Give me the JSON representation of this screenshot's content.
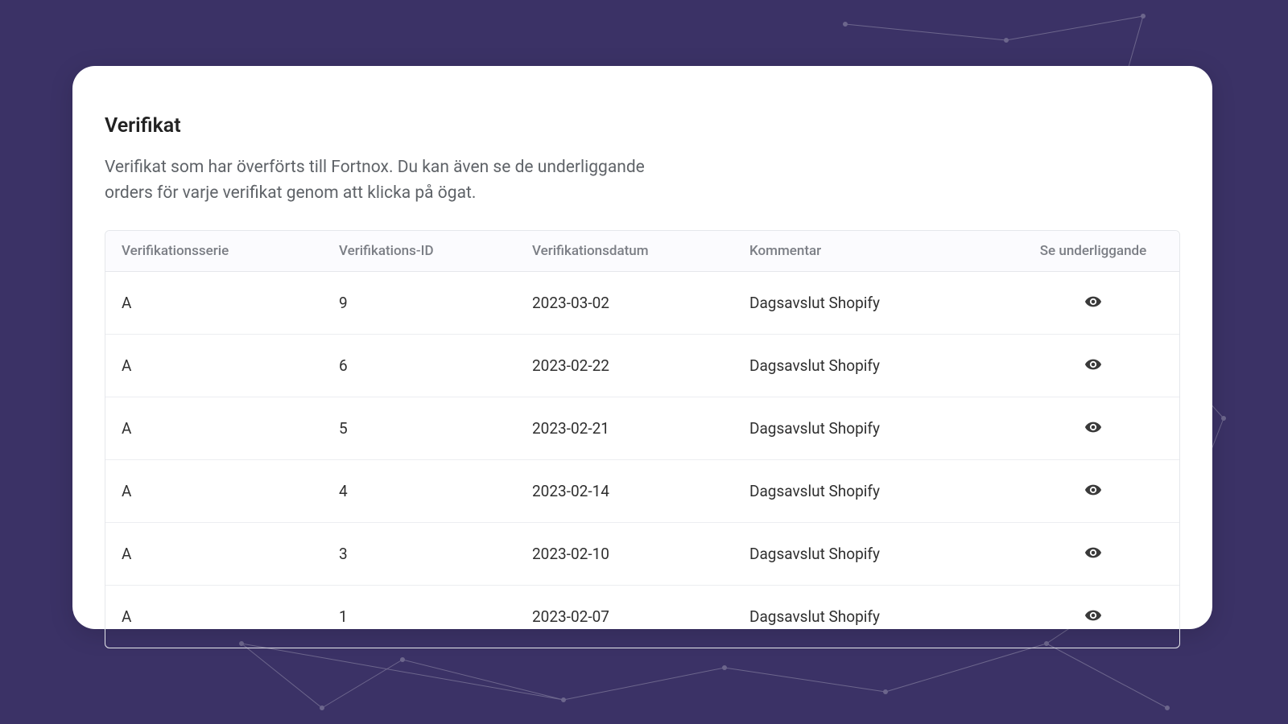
{
  "title": "Verifikat",
  "subtitle": "Verifikat som har överförts till Fortnox. Du kan även se de underliggande orders för varje verifikat genom att klicka på ögat.",
  "columns": {
    "series": "Verifikationsserie",
    "id": "Verifikations-ID",
    "date": "Verifikationsdatum",
    "comment": "Kommentar",
    "action": "Se underliggande"
  },
  "rows": [
    {
      "series": "A",
      "id": "9",
      "date": "2023-03-02",
      "comment": "Dagsavslut Shopify"
    },
    {
      "series": "A",
      "id": "6",
      "date": "2023-02-22",
      "comment": "Dagsavslut Shopify"
    },
    {
      "series": "A",
      "id": "5",
      "date": "2023-02-21",
      "comment": "Dagsavslut Shopify"
    },
    {
      "series": "A",
      "id": "4",
      "date": "2023-02-14",
      "comment": "Dagsavslut Shopify"
    },
    {
      "series": "A",
      "id": "3",
      "date": "2023-02-10",
      "comment": "Dagsavslut Shopify"
    },
    {
      "series": "A",
      "id": "1",
      "date": "2023-02-07",
      "comment": "Dagsavslut Shopify"
    }
  ],
  "colors": {
    "background": "#3b3266",
    "card": "#ffffff",
    "text_primary": "#222",
    "text_muted": "#5f6368",
    "border": "#e5e7eb"
  }
}
